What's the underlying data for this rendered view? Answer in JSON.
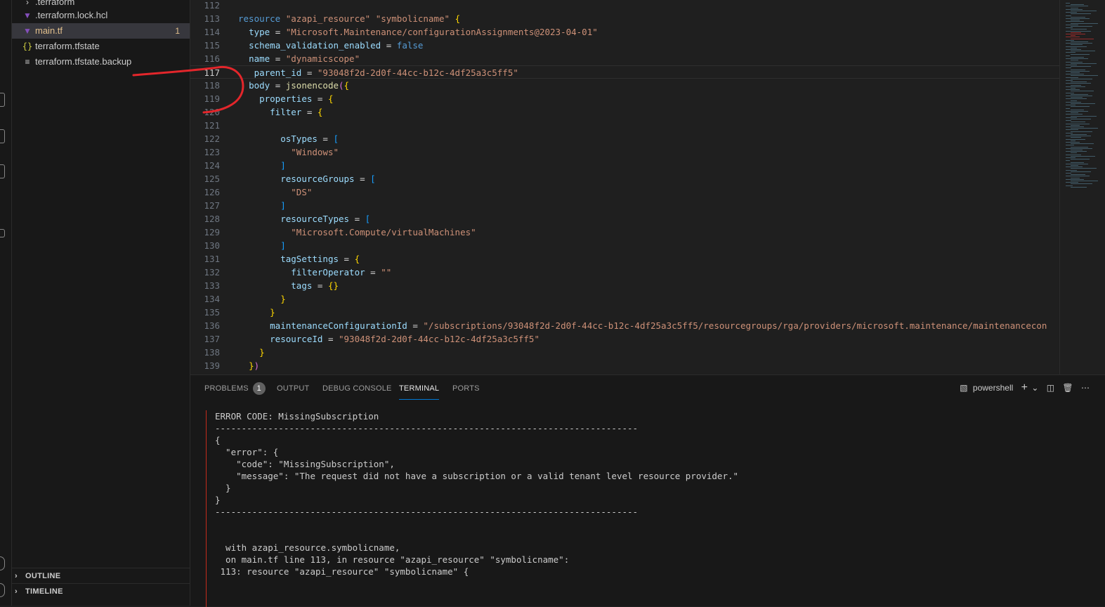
{
  "explorer": {
    "files": [
      {
        "name": ".terraform",
        "icon": "chevron-right-icon",
        "badge": ""
      },
      {
        "name": ".terraform.lock.hcl",
        "icon": "terraform-icon",
        "badge": ""
      },
      {
        "name": "main.tf",
        "icon": "terraform-icon",
        "badge": "1",
        "active": true
      },
      {
        "name": "terraform.tfstate",
        "icon": "json-braces-icon",
        "badge": ""
      },
      {
        "name": "terraform.tfstate.backup",
        "icon": "lines-icon",
        "badge": ""
      }
    ],
    "sections": [
      {
        "label": "OUTLINE"
      },
      {
        "label": "TIMELINE"
      }
    ]
  },
  "editor": {
    "current_line": "117",
    "lines": [
      {
        "n": "112",
        "text": ""
      },
      {
        "n": "113",
        "text": "resource \"azapi_resource\" \"symbolicname\" {"
      },
      {
        "n": "114",
        "text": "  type = \"Microsoft.Maintenance/configurationAssignments@2023-04-01\""
      },
      {
        "n": "115",
        "text": "  schema_validation_enabled = false"
      },
      {
        "n": "116",
        "text": "  name = \"dynamicscope\""
      },
      {
        "n": "117",
        "text": "   parent_id = \"93048f2d-2d0f-44cc-b12c-4df25a3c5ff5\""
      },
      {
        "n": "118",
        "text": "  body = jsonencode({"
      },
      {
        "n": "119",
        "text": "    properties = {"
      },
      {
        "n": "120",
        "text": "      filter = {"
      },
      {
        "n": "121",
        "text": ""
      },
      {
        "n": "122",
        "text": "        osTypes = ["
      },
      {
        "n": "123",
        "text": "          \"Windows\""
      },
      {
        "n": "124",
        "text": "        ]"
      },
      {
        "n": "125",
        "text": "        resourceGroups = ["
      },
      {
        "n": "126",
        "text": "          \"DS\""
      },
      {
        "n": "127",
        "text": "        ]"
      },
      {
        "n": "128",
        "text": "        resourceTypes = ["
      },
      {
        "n": "129",
        "text": "          \"Microsoft.Compute/virtualMachines\""
      },
      {
        "n": "130",
        "text": "        ]"
      },
      {
        "n": "131",
        "text": "        tagSettings = {"
      },
      {
        "n": "132",
        "text": "          filterOperator = \"\""
      },
      {
        "n": "133",
        "text": "          tags = {}"
      },
      {
        "n": "134",
        "text": "        }"
      },
      {
        "n": "135",
        "text": "      }"
      },
      {
        "n": "136",
        "text": "      maintenanceConfigurationId = \"/subscriptions/93048f2d-2d0f-44cc-b12c-4df25a3c5ff5/resourcegroups/rga/providers/microsoft.maintenance/maintenancecon"
      },
      {
        "n": "137",
        "text": "      resourceId = \"93048f2d-2d0f-44cc-b12c-4df25a3c5ff5\""
      },
      {
        "n": "138",
        "text": "    }"
      },
      {
        "n": "139",
        "text": "  })"
      }
    ]
  },
  "panel": {
    "tabs": [
      {
        "label": "PROBLEMS",
        "badge": "1"
      },
      {
        "label": "OUTPUT"
      },
      {
        "label": "DEBUG CONSOLE"
      },
      {
        "label": "TERMINAL",
        "active": true
      },
      {
        "label": "PORTS"
      }
    ],
    "shell_label": "powershell",
    "terminal_lines": [
      "ERROR CODE: MissingSubscription",
      "--------------------------------------------------------------------------------",
      "{",
      "  \"error\": {",
      "    \"code\": \"MissingSubscription\",",
      "    \"message\": \"The request did not have a subscription or a valid tenant level resource provider.\"",
      "  }",
      "}",
      "--------------------------------------------------------------------------------",
      "",
      "",
      "  with azapi_resource.symbolicname,",
      "  on main.tf line 113, in resource \"azapi_resource\" \"symbolicname\":",
      " 113: resource \"azapi_resource\" \"symbolicname\" {"
    ]
  },
  "colors": {
    "annotation": "#e3262b",
    "accent": "#0078d4",
    "error_rule": "#c42b1c"
  }
}
